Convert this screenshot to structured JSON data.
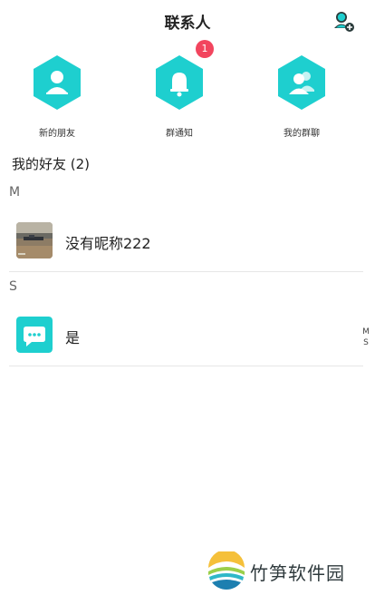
{
  "header": {
    "title": "联系人",
    "add_icon": "add-friend-icon"
  },
  "quick_actions": [
    {
      "label": "新的朋友",
      "icon": "user-icon"
    },
    {
      "label": "群通知",
      "icon": "bell-icon",
      "badge": "1"
    },
    {
      "label": "我的群聊",
      "icon": "group-icon"
    }
  ],
  "friends": {
    "title": "我的好友 (2)",
    "groups": [
      {
        "letter": "M",
        "items": [
          {
            "name": "没有昵称222",
            "avatar": "photo-avatar"
          }
        ]
      },
      {
        "letter": "S",
        "items": [
          {
            "name": "是",
            "avatar": "chat-bubble-icon"
          }
        ]
      }
    ]
  },
  "index_bar": [
    "M",
    "S"
  ],
  "watermark": {
    "text": "竹笋软件园"
  },
  "colors": {
    "accent": "#1ecfcf",
    "badge": "#f2455e",
    "divider": "#e6e6e6"
  }
}
